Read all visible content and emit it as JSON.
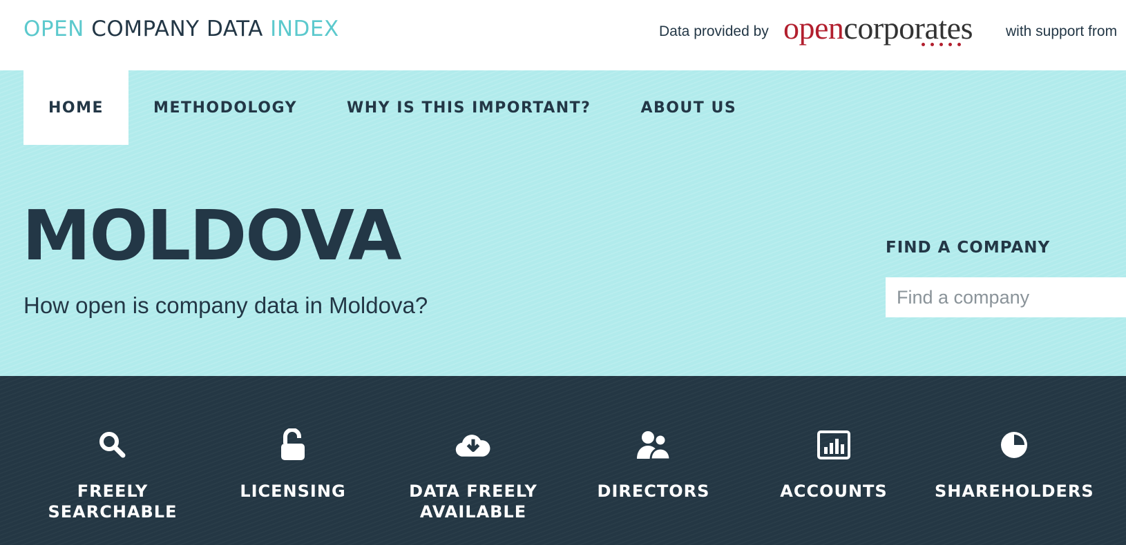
{
  "header": {
    "logo": {
      "word1": "OPEN",
      "word2": "COMPANY",
      "word3": "DATA",
      "word4": "INDEX"
    },
    "provided_by": "Data provided by",
    "provider_logo": {
      "part1": "open",
      "part2": "corporates"
    },
    "support_text": "with support from"
  },
  "nav": {
    "items": [
      {
        "label": "HOME",
        "active": true
      },
      {
        "label": "METHODOLOGY",
        "active": false
      },
      {
        "label": "WHY IS THIS IMPORTANT?",
        "active": false
      },
      {
        "label": "ABOUT US",
        "active": false
      }
    ]
  },
  "hero": {
    "country": "MOLDOVA",
    "subtitle": "How open is company data in Moldova?"
  },
  "search": {
    "title": "FIND A COMPANY",
    "placeholder": "Find a company",
    "value": ""
  },
  "features": {
    "items": [
      {
        "label_line1": "FREELY",
        "label_line2": "SEARCHABLE",
        "icon": "search-icon"
      },
      {
        "label_line1": "LICENSING",
        "label_line2": "",
        "icon": "unlock-icon"
      },
      {
        "label_line1": "DATA FREELY",
        "label_line2": "AVAILABLE",
        "icon": "cloud-download-icon"
      },
      {
        "label_line1": "DIRECTORS",
        "label_line2": "",
        "icon": "users-icon"
      },
      {
        "label_line1": "ACCOUNTS",
        "label_line2": "",
        "icon": "bar-chart-icon"
      },
      {
        "label_line1": "SHAREHOLDERS",
        "label_line2": "",
        "icon": "pie-chart-icon"
      }
    ]
  },
  "colors": {
    "teal_accent": "#5cc9cd",
    "hero_background": "#b1ebec",
    "dark_navy": "#243744",
    "opencorporates_red": "#b21f2e"
  }
}
